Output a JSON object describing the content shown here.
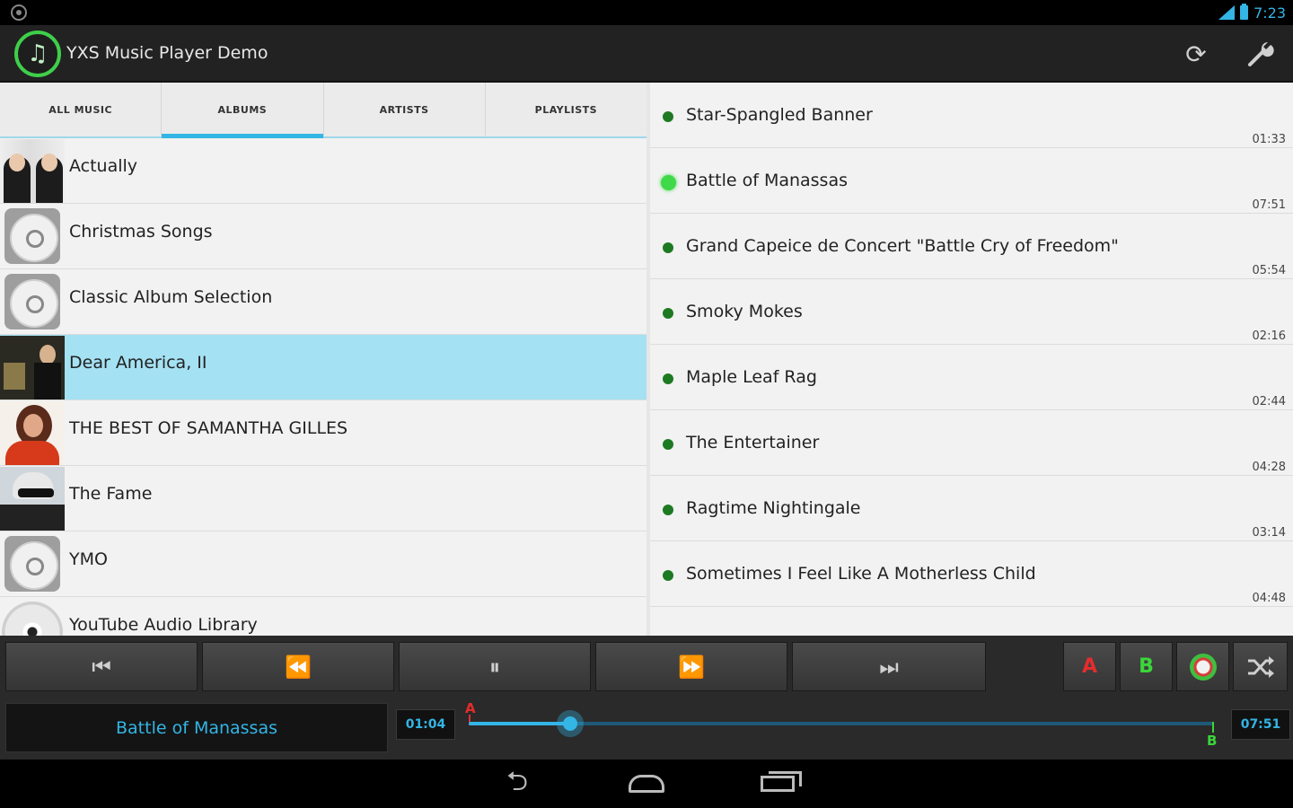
{
  "status_bar": {
    "time": "7:23"
  },
  "app": {
    "title": "YXS Music Player Demo"
  },
  "tabs": [
    {
      "label": "ALL MUSIC",
      "active": false
    },
    {
      "label": "ALBUMS",
      "active": true
    },
    {
      "label": "ARTISTS",
      "active": false
    },
    {
      "label": "PLAYLISTS",
      "active": false
    }
  ],
  "albums": [
    {
      "name": "Actually",
      "art": "cover-photo"
    },
    {
      "name": "Christmas Songs",
      "art": "cd-icon"
    },
    {
      "name": "Classic Album Selection",
      "art": "cd-icon"
    },
    {
      "name": "Dear America, II",
      "art": "cover-photo",
      "selected": true
    },
    {
      "name": "THE BEST OF SAMANTHA GILLES",
      "art": "cover-photo"
    },
    {
      "name": "The Fame",
      "art": "cover-photo"
    },
    {
      "name": "YMO",
      "art": "cd-icon"
    },
    {
      "name": "YouTube Audio Library",
      "art": "disc-icon"
    }
  ],
  "tracks": [
    {
      "title": "Star-Spangled Banner",
      "duration": "01:33"
    },
    {
      "title": "Battle of Manassas",
      "duration": "07:51",
      "playing": true
    },
    {
      "title": "Grand Capeice de Concert \"Battle Cry of Freedom\"",
      "duration": "05:54"
    },
    {
      "title": "Smoky Mokes",
      "duration": "02:16"
    },
    {
      "title": "Maple Leaf Rag",
      "duration": "02:44"
    },
    {
      "title": "The Entertainer",
      "duration": "04:28"
    },
    {
      "title": "Ragtime Nightingale",
      "duration": "03:14"
    },
    {
      "title": "Sometimes I Feel Like A Motherless Child",
      "duration": "04:48"
    }
  ],
  "player": {
    "now_playing": "Battle of Manassas",
    "current_time": "01:04",
    "total_time": "07:51",
    "progress": 0.136,
    "ab_label_a": "A",
    "ab_label_b": "B"
  },
  "colors": {
    "accent": "#33b5e5",
    "selected_row": "#a4e1f3",
    "track_dot": "#1d7a22",
    "track_dot_playing": "#3fd94a",
    "marker_a": "#e52c2c",
    "marker_b": "#3ad63a"
  },
  "icons": {
    "refresh": "refresh-icon",
    "settings": "wrench-icon",
    "prev": "skip-previous-icon",
    "rewind": "rewind-icon",
    "pause": "pause-icon",
    "forward": "fast-forward-icon",
    "next": "skip-next-icon",
    "repeat": "repeat-icon",
    "shuffle": "shuffle-icon"
  }
}
